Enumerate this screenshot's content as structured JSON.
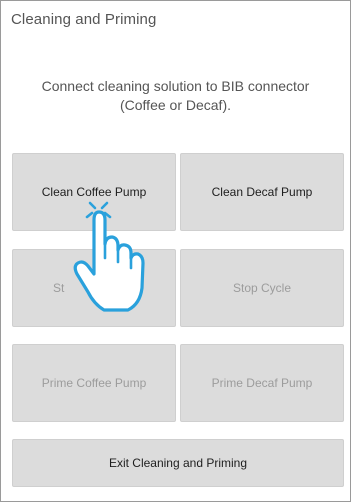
{
  "screen": {
    "title": "Cleaning and Priming",
    "instruction_line1": "Connect cleaning solution to BIB connector",
    "instruction_line2": "(Coffee or Decaf)."
  },
  "buttons": {
    "clean_coffee": "Clean Coffee Pump",
    "clean_decaf": "Clean Decaf Pump",
    "start_cycle": "St",
    "stop_cycle": "Stop Cycle",
    "prime_coffee": "Prime Coffee Pump",
    "prime_decaf": "Prime Decaf Pump",
    "exit": "Exit Cleaning and Priming"
  },
  "overlay": {
    "icon": "tap-gesture-hand-icon",
    "color": "#2aa1dc"
  }
}
